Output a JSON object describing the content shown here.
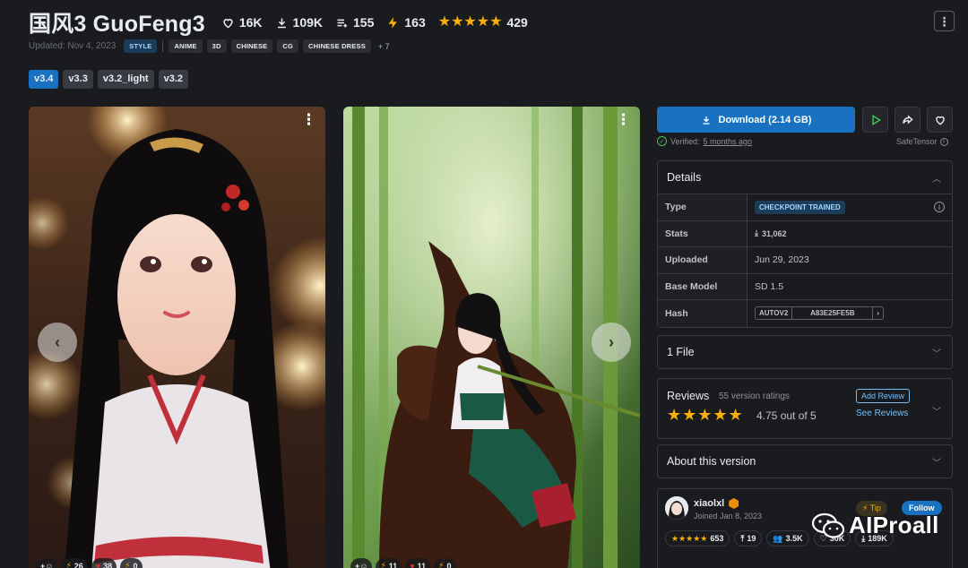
{
  "model": {
    "title": "国风3 GuoFeng3",
    "stats": {
      "likes": "16K",
      "downloads": "109K",
      "collections": "155",
      "tips": "163",
      "rating_count": "429"
    },
    "rating_stars": "★★★★★",
    "updated": "Updated: Nov 4, 2023",
    "tags": [
      "STYLE",
      "ANIME",
      "3D",
      "CHINESE",
      "CG",
      "CHINESE DRESS"
    ],
    "more_tags": "+ 7",
    "versions": [
      "v3.4",
      "v3.3",
      "v3.2_light",
      "v3.2"
    ],
    "menu_glyph": "⋮"
  },
  "gallery": {
    "card1": {
      "stats": [
        "26",
        "38",
        "0"
      ]
    },
    "card2": {
      "stats": [
        "11",
        "11",
        "0"
      ]
    }
  },
  "sidebar": {
    "download_label": "Download (2.14 GB)",
    "verified_prefix": "Verified:",
    "verified_link": "5 months ago",
    "safetensor": "SafeTensor",
    "details": {
      "heading": "Details",
      "rows": [
        {
          "key": "Type",
          "value": "CHECKPOINT TRAINED"
        },
        {
          "key": "Stats",
          "value": "31,062"
        },
        {
          "key": "Uploaded",
          "value": "Jun 29, 2023"
        },
        {
          "key": "Base Model",
          "value": "SD 1.5"
        },
        {
          "key": "Hash",
          "hash_type": "AUTOV2",
          "value": "A83E25FE5B"
        }
      ]
    },
    "files_heading": "1 File",
    "reviews": {
      "heading": "Reviews",
      "count": "55 version ratings",
      "stars": "★★★★★",
      "score": "4.75 out of 5",
      "add_label": "Add Review",
      "see_label": "See Reviews"
    },
    "about_heading": "About this version",
    "creator": {
      "name": "xiaolxl",
      "joined": "Joined Jan 8, 2023",
      "tip_label": "Tip",
      "follow_label": "Follow",
      "rating": "653",
      "uploads": "19",
      "followers": "3.5K",
      "likes": "30K",
      "downloads": "189K"
    }
  },
  "watermark": "AIProall",
  "colors": {
    "accent": "#1971c2",
    "star": "#fab005",
    "background": "#1a1b1e"
  }
}
